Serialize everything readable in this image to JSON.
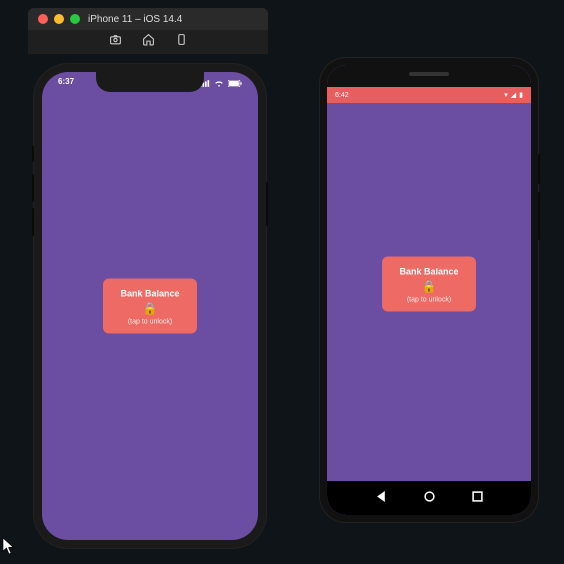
{
  "simulator": {
    "title": "iPhone 11 – iOS 14.4"
  },
  "ios": {
    "time": "6:37",
    "tile": {
      "title": "Bank Balance",
      "lock_icon": "🔒",
      "hint": "(tap to unlock)"
    }
  },
  "android": {
    "time": "6:42",
    "tile": {
      "title": "Bank Balance",
      "lock_icon": "🔒",
      "hint": "(tap to unlock)"
    }
  },
  "colors": {
    "app_bg": "#6b4da1",
    "tile_bg": "#ed6b64",
    "android_status": "#e85d5d"
  }
}
